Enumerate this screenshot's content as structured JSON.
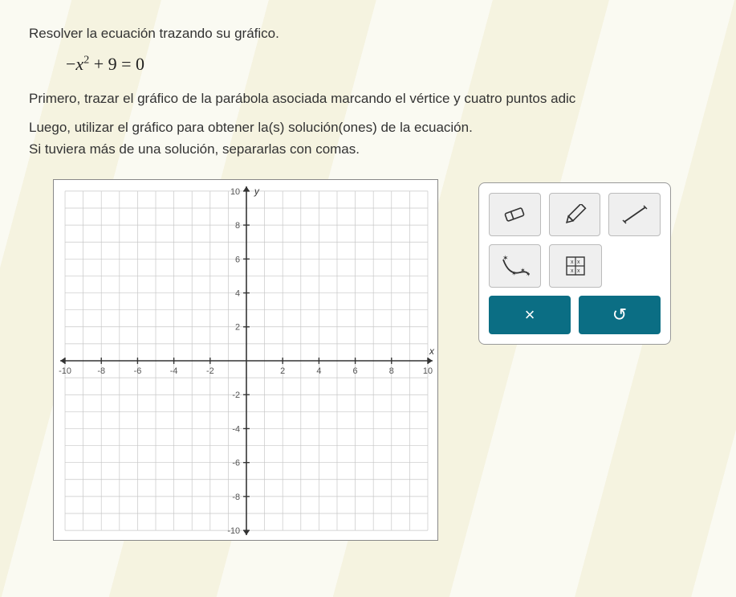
{
  "problem": {
    "title": "Resolver la ecuación trazando su gráfico.",
    "equation_lhs_minus": "−",
    "equation_var": "x",
    "equation_exp": "2",
    "equation_rest": " + 9 = 0",
    "instr2": "Primero, trazar el gráfico de la parábola asociada marcando el vértice y cuatro puntos adic",
    "instr3": "Luego, utilizar el gráfico para obtener la(s) solución(ones) de la ecuación.",
    "instr4": "Si tuviera más de una solución, separarlas con comas."
  },
  "toolbox": {
    "clear_label": "×",
    "undo_label": "↺"
  },
  "chart_data": {
    "type": "scatter",
    "title": "",
    "xlabel": "x",
    "ylabel": "y",
    "xlim": [
      -10,
      10
    ],
    "ylim": [
      -10,
      10
    ],
    "x_ticks": [
      -10,
      -8,
      -6,
      -4,
      -2,
      2,
      4,
      6,
      8,
      10
    ],
    "y_ticks": [
      -10,
      -8,
      -6,
      -4,
      -2,
      2,
      4,
      6,
      8,
      10
    ],
    "grid": true,
    "series": []
  }
}
